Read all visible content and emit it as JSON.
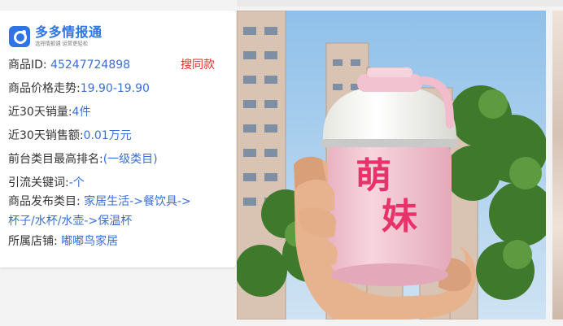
{
  "brand": {
    "name": "多多情报通",
    "slogan": "选择情报通  运营更轻松"
  },
  "product": {
    "id_label": "商品ID: ",
    "id_value": "45247724898",
    "same_style_link": "搜同款",
    "price_trend_label": "商品价格走势:",
    "price_trend_value": "19.90-19.90",
    "sales_30d_label": "近30天销量:",
    "sales_30d_value": "4件",
    "revenue_30d_label": "近30天销售额:",
    "revenue_30d_value": "0.01万元",
    "rank_label": "前台类目最高排名:",
    "rank_value": "(一级类目)",
    "keywords_label": "引流关键词:",
    "keywords_value": "-个",
    "category_label": "商品发布类目: ",
    "category_line1": "家居生活->餐饮具->",
    "category_line2": "杯子/水杯/水壶->保温杯",
    "store_label": "所属店铺: ",
    "store_value": "嘟嘟鸟家居"
  },
  "photo": {
    "cup_text_1": "萌",
    "cup_text_2": "妹"
  },
  "colors": {
    "brand_blue": "#2f74e6",
    "link_blue": "#3a6fd8",
    "accent_red": "#e02e24",
    "cup_pink": "#f3c9d6",
    "cup_text": "#e8336a"
  }
}
